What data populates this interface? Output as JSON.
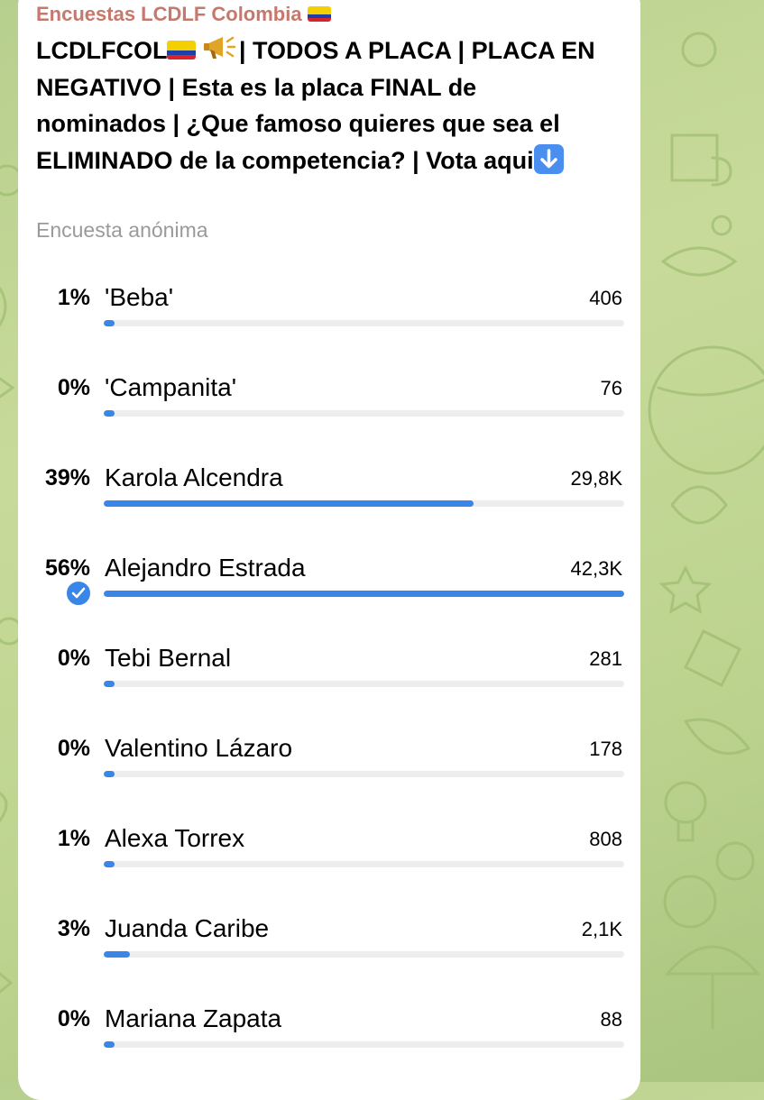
{
  "channel": {
    "name": "Encuestas LCDLF Colombia",
    "flag_icon": "colombia-flag-icon"
  },
  "poll": {
    "question_prefix": "LCDLFCOL",
    "question_text": "| TODOS A PLACA | PLACA EN NEGATIVO | Esta es la placa FINAL de nominados | ¿Que famoso quieres que sea el ELIMINADO de la competencia? | Vota aqui",
    "icons": [
      "colombia-flag-icon",
      "megaphone-icon",
      "down-arrow-icon"
    ],
    "type_label": "Encuesta anónima",
    "accent_color": "#3a86e8",
    "options": [
      {
        "percent": "1%",
        "label": "'Beba'",
        "votes": "406",
        "fill": 0.01,
        "selected": false
      },
      {
        "percent": "0%",
        "label": "'Campanita'",
        "votes": "76",
        "fill": 0.0,
        "selected": false
      },
      {
        "percent": "39%",
        "label": "Karola Alcendra",
        "votes": "29,8K",
        "fill": 0.71,
        "selected": false
      },
      {
        "percent": "56%",
        "label": "Alejandro Estrada",
        "votes": "42,3K",
        "fill": 1.0,
        "selected": true
      },
      {
        "percent": "0%",
        "label": "Tebi Bernal",
        "votes": "281",
        "fill": 0.0,
        "selected": false
      },
      {
        "percent": "0%",
        "label": "Valentino Lázaro",
        "votes": "178",
        "fill": 0.0,
        "selected": false
      },
      {
        "percent": "1%",
        "label": "Alexa Torrex",
        "votes": "808",
        "fill": 0.02,
        "selected": false
      },
      {
        "percent": "3%",
        "label": "Juanda Caribe",
        "votes": "2,1K",
        "fill": 0.05,
        "selected": false
      },
      {
        "percent": "0%",
        "label": "Mariana Zapata",
        "votes": "88",
        "fill": 0.0,
        "selected": false
      }
    ]
  }
}
